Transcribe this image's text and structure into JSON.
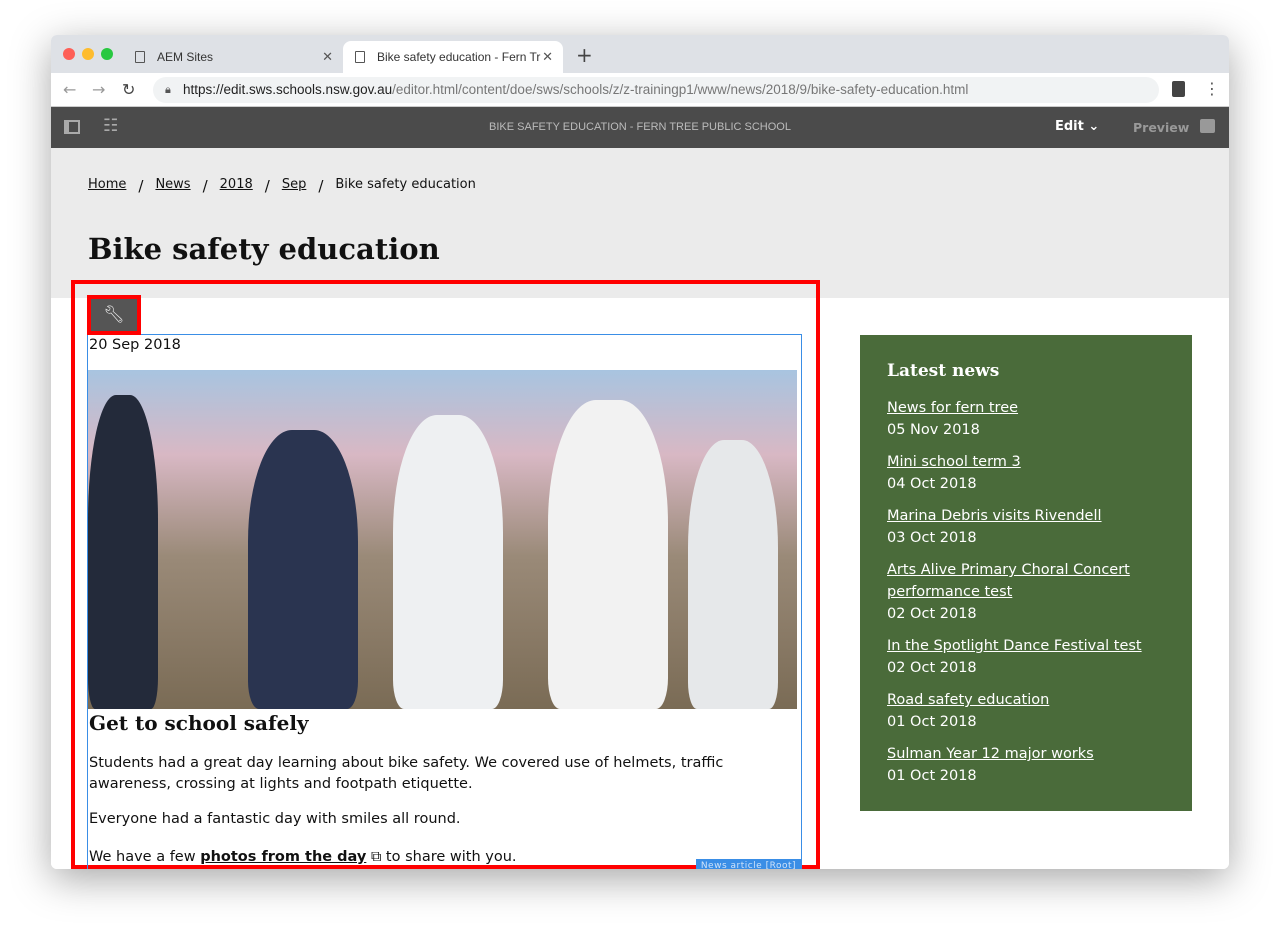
{
  "browser": {
    "tabs": [
      {
        "label": "AEM Sites"
      },
      {
        "label": "Bike safety education - Fern Tr"
      }
    ],
    "url_host": "https://edit.sws.schools.nsw.gov.au",
    "url_path": "/editor.html/content/doe/sws/schools/z/z-trainingp1/www/news/2018/9/bike-safety-education.html"
  },
  "editor": {
    "page_title": "BIKE SAFETY EDUCATION - FERN TREE PUBLIC SCHOOL",
    "mode_label": "Edit",
    "preview_label": "Preview"
  },
  "breadcrumb": [
    {
      "label": "Home"
    },
    {
      "label": "News"
    },
    {
      "label": "2018"
    },
    {
      "label": "Sep"
    },
    {
      "label": "Bike safety education"
    }
  ],
  "page": {
    "title": "Bike safety education",
    "date": "20 Sep 2018",
    "subheading": "Get to school safely",
    "para1": "Students had a great day learning about bike safety. We covered use of helmets, traffic awareness, crossing at lights and footpath etiquette.",
    "para2": "Everyone had a fantastic day with smiles all round.",
    "para3_before": "We have a few ",
    "para3_link": "photos from the day",
    "para3_after": " to share with you.",
    "component_tag": "News article [Root]"
  },
  "sidebar": {
    "title": "Latest news",
    "items": [
      {
        "title": "News for fern tree",
        "date": "05 Nov 2018"
      },
      {
        "title": "Mini school term 3",
        "date": "04 Oct 2018"
      },
      {
        "title": "Marina Debris visits Rivendell",
        "date": "03 Oct 2018"
      },
      {
        "title": "Arts Alive Primary Choral Concert performance test",
        "date": "02 Oct 2018"
      },
      {
        "title": "In the Spotlight Dance Festival test",
        "date": "02 Oct 2018"
      },
      {
        "title": "Road safety education",
        "date": "01 Oct 2018"
      },
      {
        "title": "Sulman Year 12 major works",
        "date": "01 Oct 2018"
      }
    ]
  },
  "colors": {
    "sidebar": "#4a6b3a",
    "highlight": "#ff0000",
    "component_outline": "#3a8ee6",
    "toolbar": "#4b4b4b"
  }
}
